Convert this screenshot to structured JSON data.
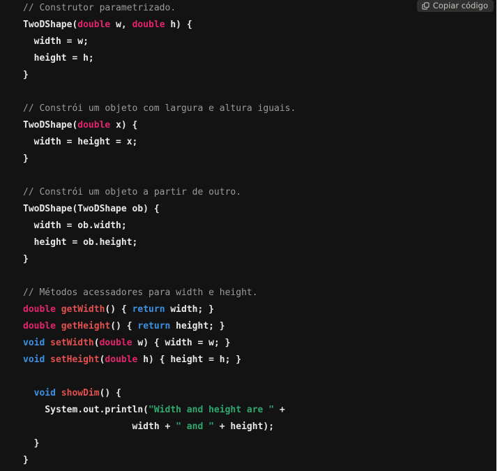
{
  "colors": {
    "page_background": "#ffffff",
    "code_background": "#131313",
    "default_text": "#e8e8e8",
    "comment": "#9b9b9b",
    "type_keyword": "#e3256b",
    "method_name": "#e35050",
    "control_keyword": "#3c91e6",
    "string_literal": "#2ea86f",
    "button_background": "#2f2f2f",
    "button_text": "#c7c3bb"
  },
  "toolbar": {
    "copy_label": "Copiar código",
    "copy_icon": "copy-icon"
  },
  "code": {
    "language": "java",
    "lines": [
      [
        {
          "t": "// Construtor parametrizado.",
          "c": "cm"
        }
      ],
      [
        {
          "t": "TwoDShape(",
          "c": "pl"
        },
        {
          "t": "double",
          "c": "ty"
        },
        {
          "t": " w, ",
          "c": "pl"
        },
        {
          "t": "double",
          "c": "ty"
        },
        {
          "t": " h) {",
          "c": "pl"
        }
      ],
      [
        {
          "t": "  width = w;",
          "c": "pl"
        }
      ],
      [
        {
          "t": "  height = h;",
          "c": "pl"
        }
      ],
      [
        {
          "t": "}",
          "c": "pl"
        }
      ],
      [
        {
          "t": "",
          "c": "pl"
        }
      ],
      [
        {
          "t": "// Constrói um objeto com largura e altura iguais.",
          "c": "cm"
        }
      ],
      [
        {
          "t": "TwoDShape(",
          "c": "pl"
        },
        {
          "t": "double",
          "c": "ty"
        },
        {
          "t": " x) {",
          "c": "pl"
        }
      ],
      [
        {
          "t": "  width = height = x;",
          "c": "pl"
        }
      ],
      [
        {
          "t": "}",
          "c": "pl"
        }
      ],
      [
        {
          "t": "",
          "c": "pl"
        }
      ],
      [
        {
          "t": "// Constrói um objeto a partir de outro.",
          "c": "cm"
        }
      ],
      [
        {
          "t": "TwoDShape(TwoDShape ob) {",
          "c": "pl"
        }
      ],
      [
        {
          "t": "  width = ob.width;",
          "c": "pl"
        }
      ],
      [
        {
          "t": "  height = ob.height;",
          "c": "pl"
        }
      ],
      [
        {
          "t": "}",
          "c": "pl"
        }
      ],
      [
        {
          "t": "",
          "c": "pl"
        }
      ],
      [
        {
          "t": "// Métodos acessadores para width e height.",
          "c": "cm"
        }
      ],
      [
        {
          "t": "double",
          "c": "ty"
        },
        {
          "t": " ",
          "c": "pl"
        },
        {
          "t": "getWidth",
          "c": "fn"
        },
        {
          "t": "() { ",
          "c": "pl"
        },
        {
          "t": "return",
          "c": "kw"
        },
        {
          "t": " width; }",
          "c": "pl"
        }
      ],
      [
        {
          "t": "double",
          "c": "ty"
        },
        {
          "t": " ",
          "c": "pl"
        },
        {
          "t": "getHeight",
          "c": "fn"
        },
        {
          "t": "() { ",
          "c": "pl"
        },
        {
          "t": "return",
          "c": "kw"
        },
        {
          "t": " height; }",
          "c": "pl"
        }
      ],
      [
        {
          "t": "void",
          "c": "kw"
        },
        {
          "t": " ",
          "c": "pl"
        },
        {
          "t": "setWidth",
          "c": "fn"
        },
        {
          "t": "(",
          "c": "pl"
        },
        {
          "t": "double",
          "c": "ty"
        },
        {
          "t": " w) { width = w; }",
          "c": "pl"
        }
      ],
      [
        {
          "t": "void",
          "c": "kw"
        },
        {
          "t": " ",
          "c": "pl"
        },
        {
          "t": "setHeight",
          "c": "fn"
        },
        {
          "t": "(",
          "c": "pl"
        },
        {
          "t": "double",
          "c": "ty"
        },
        {
          "t": " h) { height = h; }",
          "c": "pl"
        }
      ],
      [
        {
          "t": "",
          "c": "pl"
        }
      ],
      [
        {
          "t": "  ",
          "c": "pl"
        },
        {
          "t": "void",
          "c": "kw"
        },
        {
          "t": " ",
          "c": "pl"
        },
        {
          "t": "showDim",
          "c": "fn"
        },
        {
          "t": "() {",
          "c": "pl"
        }
      ],
      [
        {
          "t": "    System.out.println(",
          "c": "pl"
        },
        {
          "t": "\"Width and height are \"",
          "c": "st"
        },
        {
          "t": " +",
          "c": "pl"
        }
      ],
      [
        {
          "t": "                    width + ",
          "c": "pl"
        },
        {
          "t": "\" and \"",
          "c": "st"
        },
        {
          "t": " + height);",
          "c": "pl"
        }
      ],
      [
        {
          "t": "  }",
          "c": "pl"
        }
      ],
      [
        {
          "t": "}",
          "c": "pl"
        }
      ]
    ]
  }
}
